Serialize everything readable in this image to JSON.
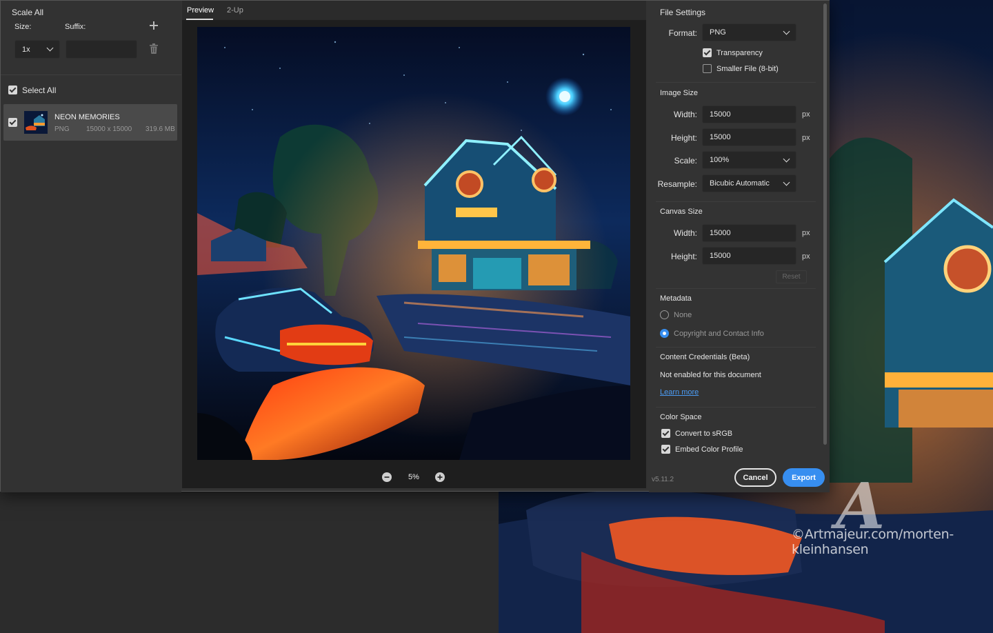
{
  "left_panel": {
    "scale_all_label": "Scale All",
    "size_label": "Size:",
    "suffix_label": "Suffix:",
    "size_value": "1x",
    "suffix_value": "",
    "select_all_label": "Select All",
    "asset": {
      "name": "NEON MEMORIES",
      "format": "PNG",
      "dimensions": "15000 x 15000",
      "filesize": "319.6 MB"
    }
  },
  "preview": {
    "tabs": [
      "Preview",
      "2-Up"
    ],
    "active_tab": "Preview",
    "zoom": "5%"
  },
  "file_settings": {
    "title": "File Settings",
    "format_label": "Format:",
    "format_value": "PNG",
    "transparency_label": "Transparency",
    "transparency_checked": true,
    "smaller_file_label": "Smaller File (8-bit)",
    "smaller_file_checked": false
  },
  "image_size": {
    "title": "Image Size",
    "width_label": "Width:",
    "width_value": "15000",
    "height_label": "Height:",
    "height_value": "15000",
    "unit": "px",
    "scale_label": "Scale:",
    "scale_value": "100%",
    "resample_label": "Resample:",
    "resample_value": "Bicubic Automatic"
  },
  "canvas_size": {
    "title": "Canvas Size",
    "width_label": "Width:",
    "width_value": "15000",
    "height_label": "Height:",
    "height_value": "15000",
    "unit": "px",
    "reset_label": "Reset"
  },
  "metadata": {
    "title": "Metadata",
    "options": [
      "None",
      "Copyright and Contact Info"
    ],
    "selected": "Copyright and Contact Info"
  },
  "content_credentials": {
    "title": "Content Credentials (Beta)",
    "status": "Not enabled for this document",
    "learn_more": "Learn more"
  },
  "color_space": {
    "title": "Color Space",
    "convert_label": "Convert to sRGB",
    "convert_checked": true,
    "embed_label": "Embed Color Profile",
    "embed_checked": true
  },
  "footer": {
    "version": "v5.11.2",
    "cancel_label": "Cancel",
    "export_label": "Export"
  },
  "watermark": {
    "logo": "A",
    "text": "©Artmajeur.com/morten-kleinhansen"
  },
  "colors": {
    "accent": "#378ef0",
    "dialog_bg": "#333333",
    "field_bg": "#262626"
  }
}
